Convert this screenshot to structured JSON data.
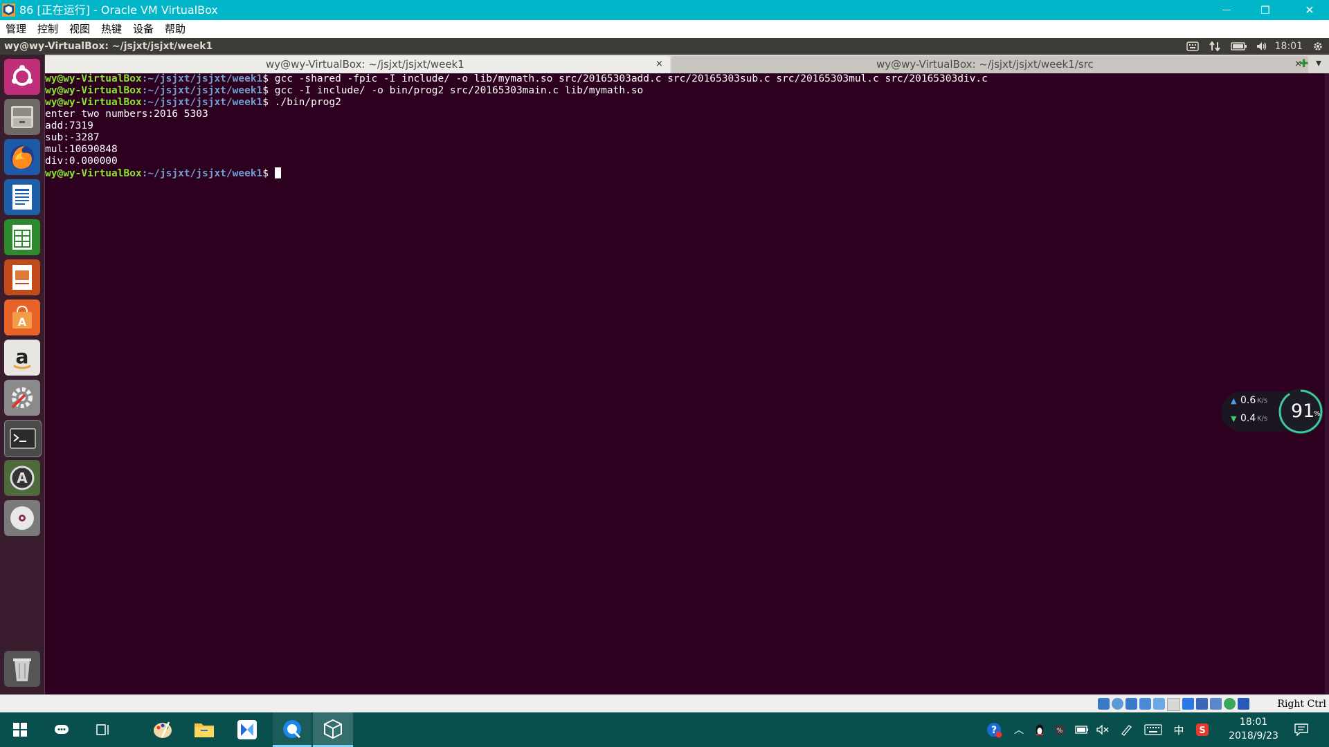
{
  "host_window": {
    "title": "86 [正在运行] - Oracle VM VirtualBox",
    "minimize_glyph": "—",
    "restore_glyph": "❐",
    "close_glyph": "✕"
  },
  "host_menu": {
    "items": [
      {
        "label": "管理"
      },
      {
        "label": "控制"
      },
      {
        "label": "视图"
      },
      {
        "label": "热键"
      },
      {
        "label": "设备"
      },
      {
        "label": "帮助"
      }
    ]
  },
  "ubuntu_panel": {
    "window_title": "wy@wy-VirtualBox: ~/jsjxt/jsjxt/week1",
    "clock": "18:01",
    "icons": [
      "keyboard-icon",
      "network-icon",
      "battery-icon",
      "volume-icon",
      "gear-icon"
    ]
  },
  "launcher": {
    "items": [
      "ubuntu-dash",
      "files",
      "firefox",
      "libreoffice-writer",
      "libreoffice-calc",
      "libreoffice-impress",
      "ubuntu-software",
      "amazon",
      "system-settings",
      "terminal",
      "software-updater",
      "dvd",
      "trash"
    ]
  },
  "terminal": {
    "tabs": [
      {
        "label": "wy@wy-VirtualBox: ~/jsjxt/jsjxt/week1",
        "close": "×",
        "active": true
      },
      {
        "label": "wy@wy-VirtualBox: ~/jsjxt/jsjxt/week1/src",
        "close": "×",
        "active": false
      }
    ],
    "new_tab_glyph": "✚",
    "menu_glyph": "▾",
    "prompt_user": "wy@wy-VirtualBox",
    "prompt_path": ":~/jsjxt/jsjxt/week1",
    "prompt_symbol": "$ ",
    "lines": [
      {
        "kind": "cmd",
        "text": "gcc -shared -fpic -I include/ -o lib/mymath.so src/20165303add.c src/20165303sub.c src/20165303mul.c src/20165303div.c"
      },
      {
        "kind": "cmd",
        "text": "gcc -I include/ -o bin/prog2 src/20165303main.c lib/mymath.so"
      },
      {
        "kind": "cmd",
        "text": "./bin/prog2"
      },
      {
        "kind": "out",
        "text": "enter two numbers:2016 5303"
      },
      {
        "kind": "out",
        "text": "add:7319"
      },
      {
        "kind": "out",
        "text": "sub:-3287"
      },
      {
        "kind": "out",
        "text": "mul:10690848"
      },
      {
        "kind": "out",
        "text": "div:0.000000"
      },
      {
        "kind": "prompt",
        "text": ""
      }
    ]
  },
  "net_monitor": {
    "up": "0.6",
    "down": "0.4",
    "unit": "K/s",
    "percent": "91",
    "percent_sign": "%"
  },
  "vbox_status": {
    "host_key": "Right Ctrl"
  },
  "taskbar": {
    "time": "18:01",
    "date": "2018/9/23",
    "ime": "中",
    "pinned": [
      "windows-start",
      "cortana",
      "task-view",
      "paint",
      "file-explorer",
      "app",
      "browser",
      "virtualbox"
    ]
  },
  "colors": {
    "terminal_bg": "#2c001e",
    "prompt_user": "#8ae234",
    "prompt_path": "#729fcf",
    "titlebar": "#00b6c8",
    "taskbar": "#084f4e"
  }
}
